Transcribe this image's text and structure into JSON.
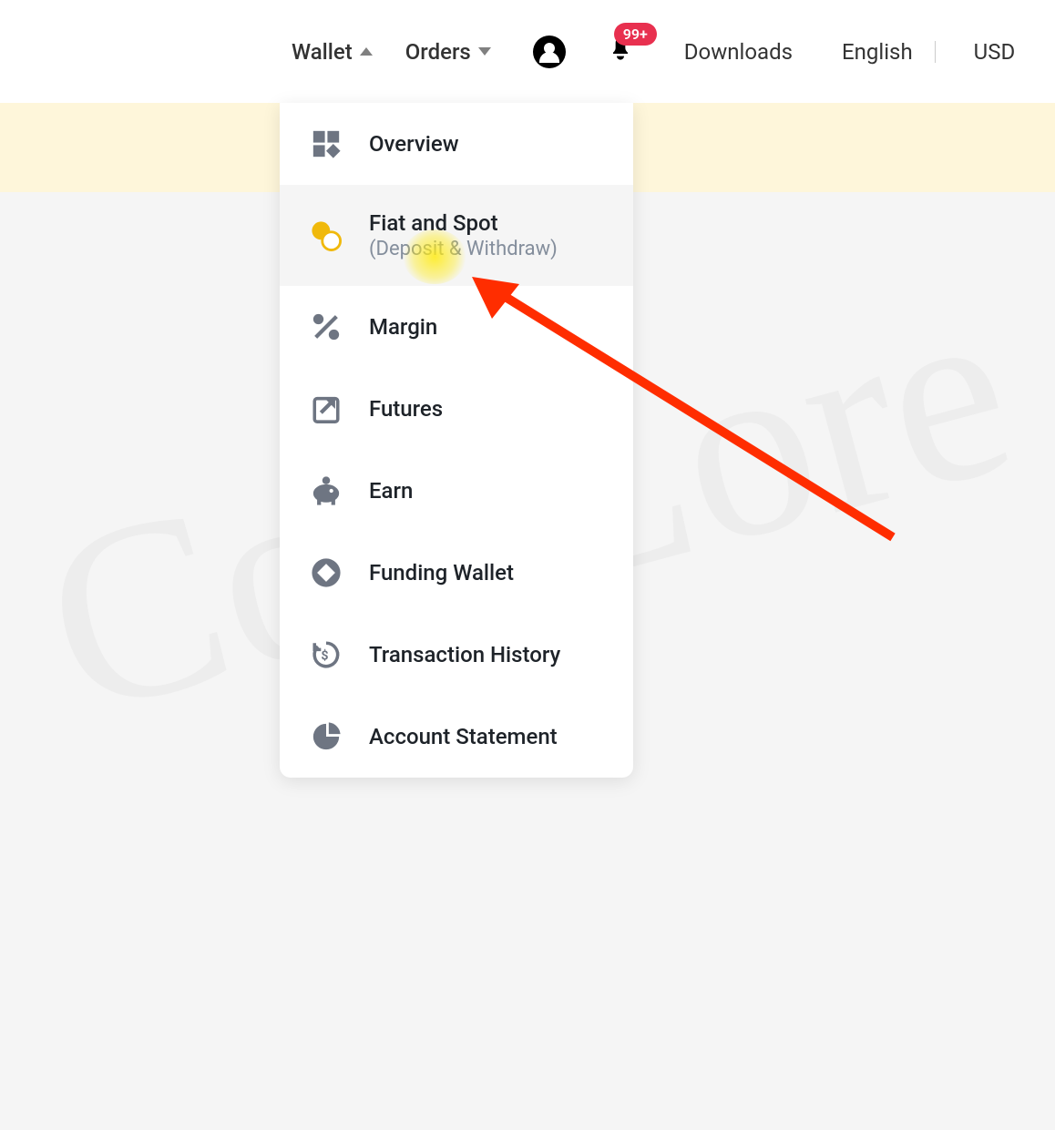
{
  "header": {
    "wallet": "Wallet",
    "orders": "Orders",
    "downloads": "Downloads",
    "english": "English",
    "currency": "USD",
    "notification_badge": "99+"
  },
  "dropdown": {
    "items": [
      {
        "label": "Overview",
        "icon": "grid"
      },
      {
        "label": "Fiat and Spot",
        "sublabel": "(Deposit & Withdraw)",
        "icon": "exchange",
        "hovered": true
      },
      {
        "label": "Margin",
        "icon": "percent"
      },
      {
        "label": "Futures",
        "icon": "chart-up"
      },
      {
        "label": "Earn",
        "icon": "piggy-bank"
      },
      {
        "label": "Funding Wallet",
        "icon": "diamond-circle"
      },
      {
        "label": "Transaction History",
        "icon": "history"
      },
      {
        "label": "Account Statement",
        "icon": "pie"
      }
    ]
  },
  "watermark": "CoinLore"
}
